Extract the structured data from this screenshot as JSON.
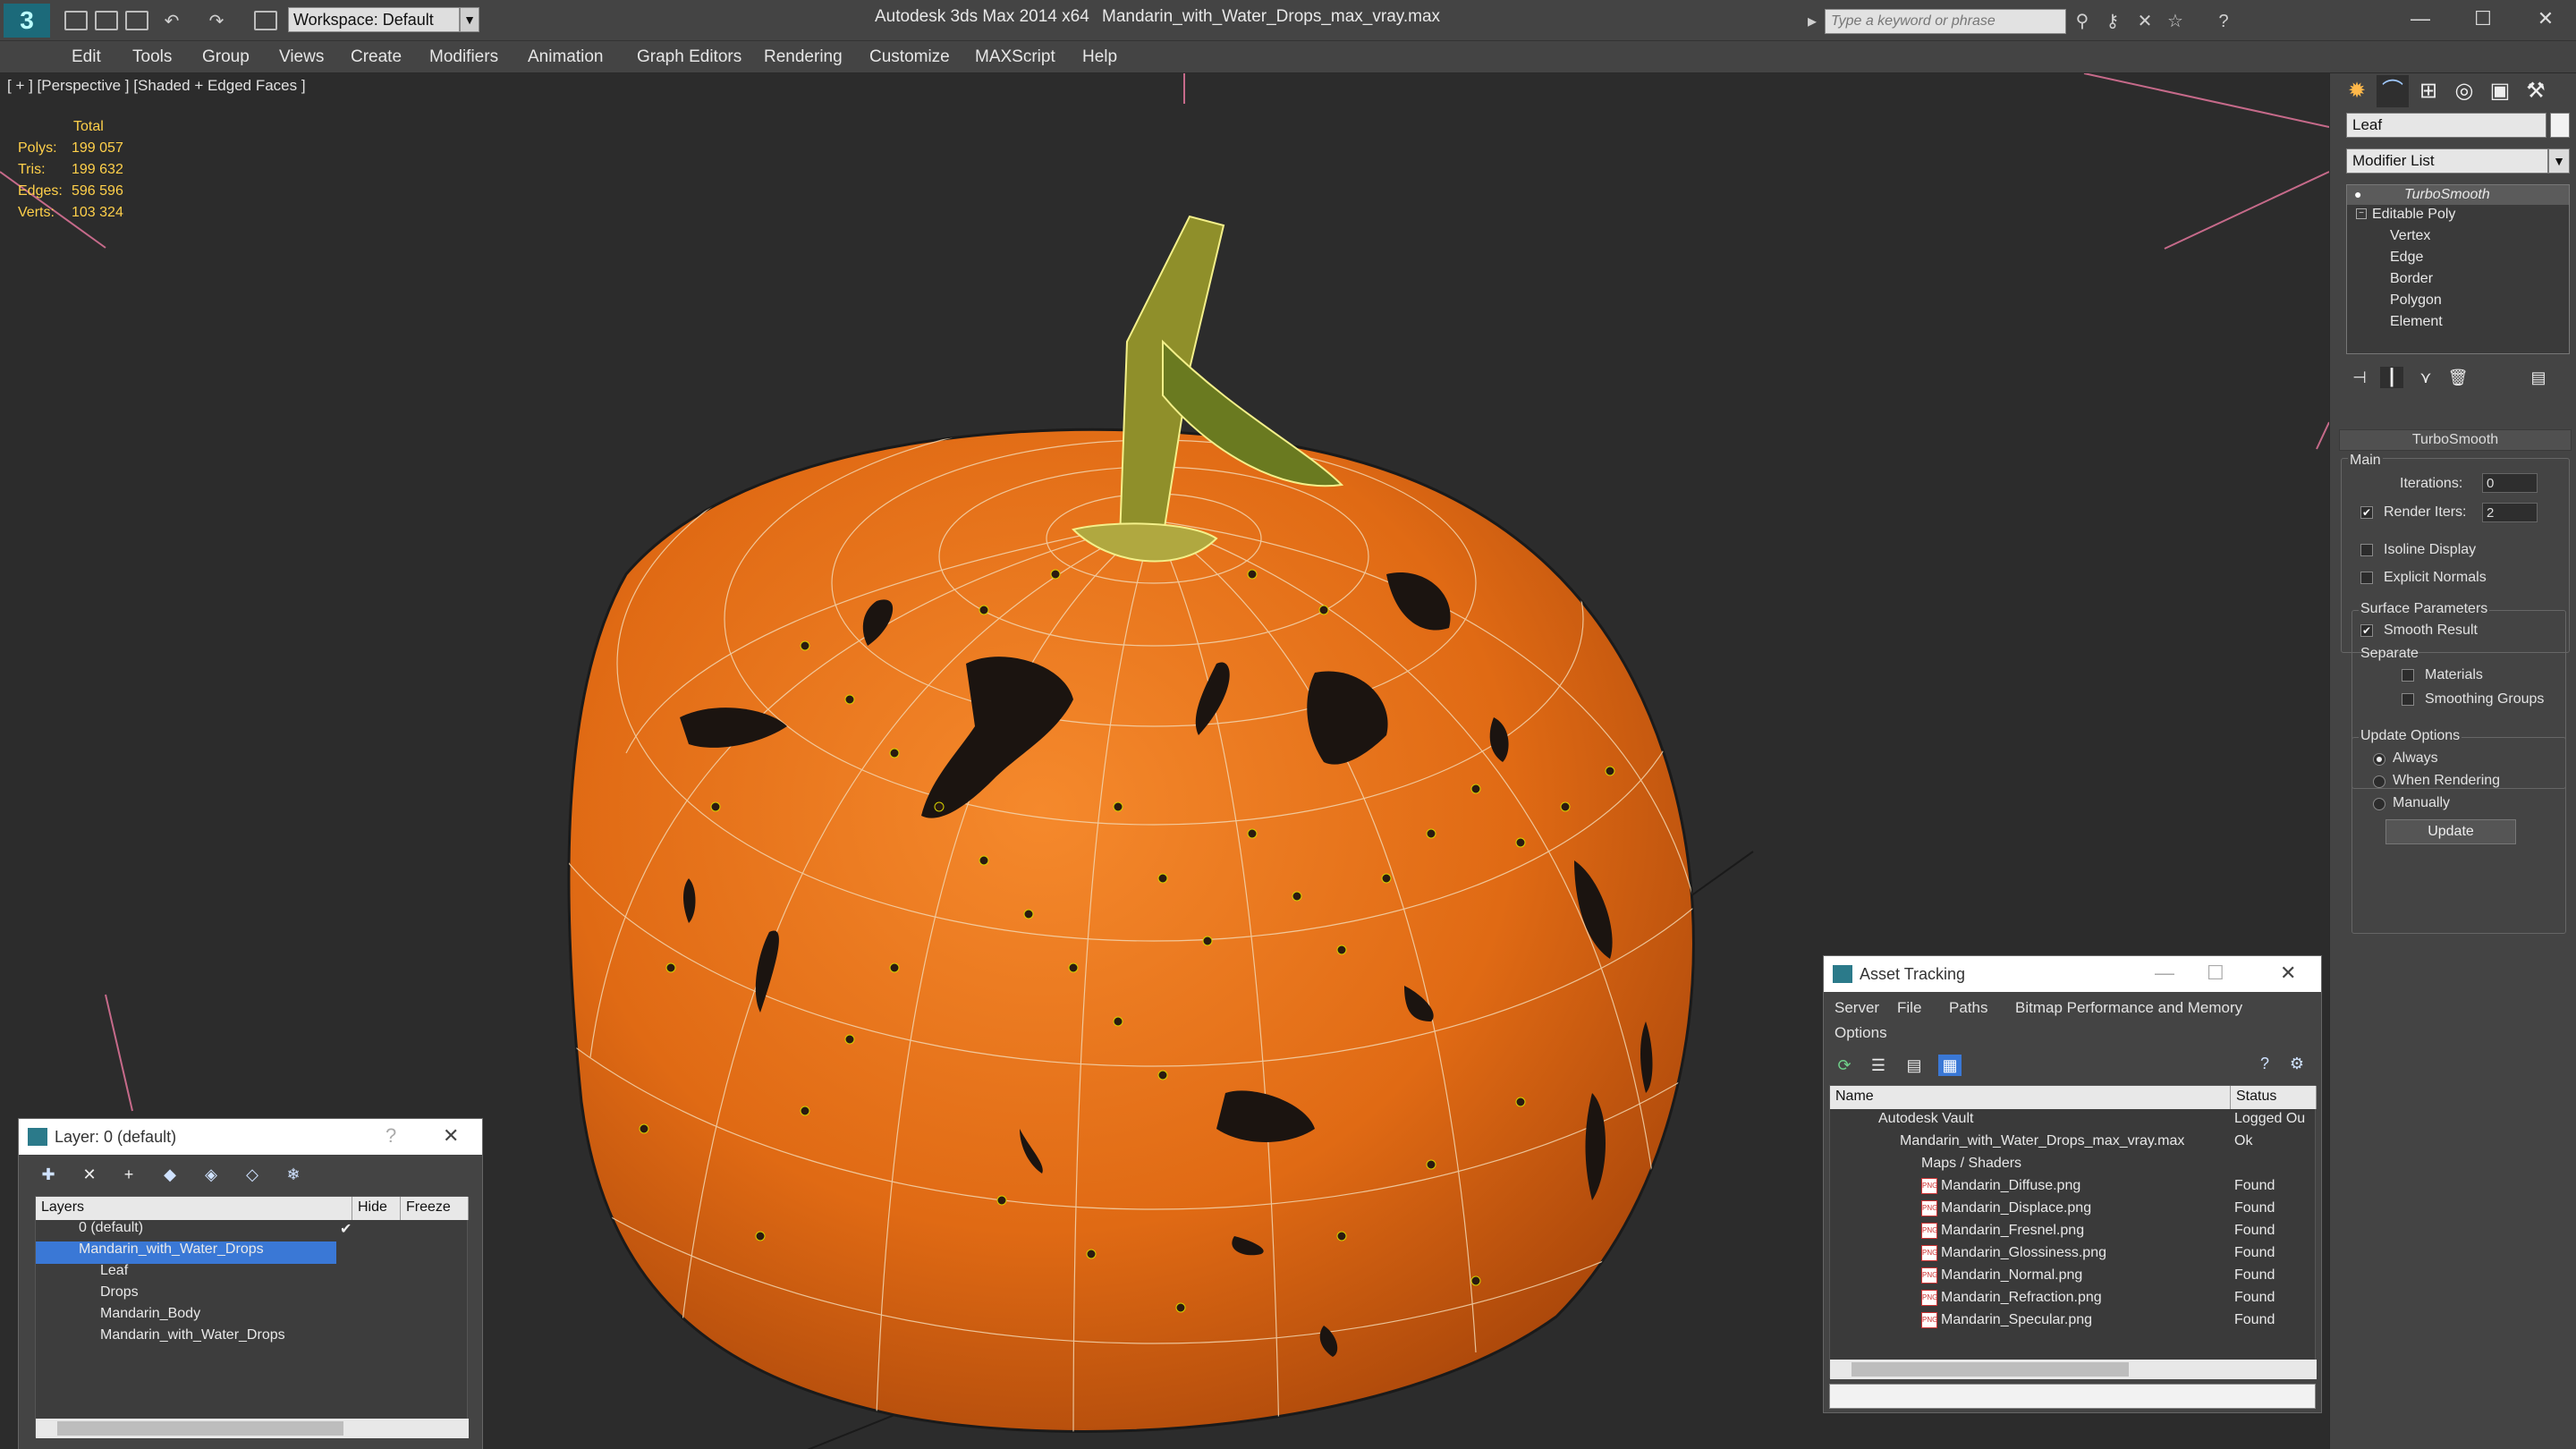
{
  "app": {
    "title": "Autodesk 3ds Max  2014 x64",
    "file": "Mandarin_with_Water_Drops_max_vray.max",
    "workspace": "Workspace: Default",
    "search_placeholder": "Type a keyword or phrase"
  },
  "menu": [
    "Edit",
    "Tools",
    "Group",
    "Views",
    "Create",
    "Modifiers",
    "Animation",
    "Graph Editors",
    "Rendering",
    "Customize",
    "MAXScript",
    "Help"
  ],
  "viewport": {
    "label": "[ + ] [Perspective ] [Shaded + Edged Faces ]",
    "stats_header": "Total",
    "stats": [
      {
        "k": "Polys:",
        "v": "199 057"
      },
      {
        "k": "Tris:",
        "v": "199 632"
      },
      {
        "k": "Edges:",
        "v": "596 596"
      },
      {
        "k": "Verts:",
        "v": "103 324"
      }
    ]
  },
  "command_panel": {
    "object_name": "Leaf",
    "modifier_list": "Modifier List",
    "stack": {
      "top": "TurboSmooth",
      "base": "Editable Poly",
      "subs": [
        "Vertex",
        "Edge",
        "Border",
        "Polygon",
        "Element"
      ]
    },
    "rollout": {
      "title": "TurboSmooth",
      "main_label": "Main",
      "iterations_label": "Iterations:",
      "iterations_value": "0",
      "render_iters_label": "Render Iters:",
      "render_iters_value": "2",
      "isoline": "Isoline Display",
      "explicit": "Explicit Normals",
      "surface_label": "Surface Parameters",
      "smooth_result": "Smooth Result",
      "separate_label": "Separate",
      "materials": "Materials",
      "smoothing_groups": "Smoothing Groups",
      "update_label": "Update Options",
      "always": "Always",
      "when_rendering": "When Rendering",
      "manually": "Manually",
      "update_button": "Update"
    }
  },
  "layers_panel": {
    "title": "Layer: 0 (default)",
    "help": "?",
    "col_layers": "Layers",
    "col_hide": "Hide",
    "col_freeze": "Freeze",
    "rows": [
      "0 (default)",
      "Mandarin_with_Water_Drops",
      "Leaf",
      "Drops",
      "Mandarin_Body",
      "Mandarin_with_Water_Drops"
    ]
  },
  "asset_panel": {
    "title": "Asset Tracking",
    "menu": [
      "Server",
      "File",
      "Paths",
      "Bitmap Performance and Memory",
      "Options"
    ],
    "col_name": "Name",
    "col_status": "Status",
    "rows": [
      {
        "name": "Autodesk Vault",
        "status": "Logged Ou"
      },
      {
        "name": "Mandarin_with_Water_Drops_max_vray.max",
        "status": "Ok"
      },
      {
        "name": "Maps / Shaders",
        "status": ""
      },
      {
        "name": "Mandarin_Diffuse.png",
        "status": "Found"
      },
      {
        "name": "Mandarin_Displace.png",
        "status": "Found"
      },
      {
        "name": "Mandarin_Fresnel.png",
        "status": "Found"
      },
      {
        "name": "Mandarin_Glossiness.png",
        "status": "Found"
      },
      {
        "name": "Mandarin_Normal.png",
        "status": "Found"
      },
      {
        "name": "Mandarin_Refraction.png",
        "status": "Found"
      },
      {
        "name": "Mandarin_Specular.png",
        "status": "Found"
      }
    ]
  },
  "colors": {
    "fruit": "#e8741a",
    "stats": "#ffd04a",
    "selection": "#3a78d6"
  }
}
